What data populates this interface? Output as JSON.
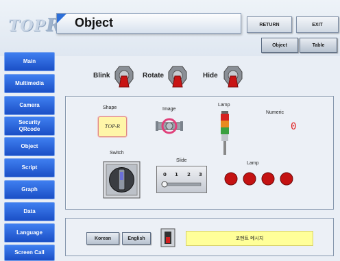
{
  "header": {
    "logo_text": "TOP",
    "logo_r": "R",
    "title": "Object",
    "return_label": "RETURN",
    "exit_label": "EXIT",
    "object_tab": "Object",
    "table_tab": "Table"
  },
  "sidebar": {
    "items": [
      {
        "label": "Main"
      },
      {
        "label": "Multimedia"
      },
      {
        "label": "Camera"
      },
      {
        "label": "Security\nQRcode"
      },
      {
        "label": "Object"
      },
      {
        "label": "Script"
      },
      {
        "label": "Graph"
      },
      {
        "label": "Data"
      },
      {
        "label": "Language"
      },
      {
        "label": "Screen Call"
      }
    ]
  },
  "actions": {
    "blink": "Blink",
    "rotate": "Rotate",
    "hide": "Hide"
  },
  "objects": {
    "shape_label": "Shape",
    "shape_text": "TOP-R",
    "image_label": "Image",
    "lamp_label": "Lamp",
    "numeric_label": "Numeric",
    "numeric_value": "0",
    "switch_label": "Switch",
    "slide_label": "Slide",
    "slide_ticks": [
      "0",
      "1",
      "2",
      "3"
    ],
    "slide_value": 0,
    "lamp2_label": "Lamp"
  },
  "bottom": {
    "korean_label": "Korean",
    "english_label": "English",
    "message": "코멘트 메시지"
  },
  "colors": {
    "sidebar_blue": "#1b4fc6",
    "accent_red": "#d01818",
    "message_yellow": "#ffff99",
    "numeric_red": "#e02020"
  }
}
